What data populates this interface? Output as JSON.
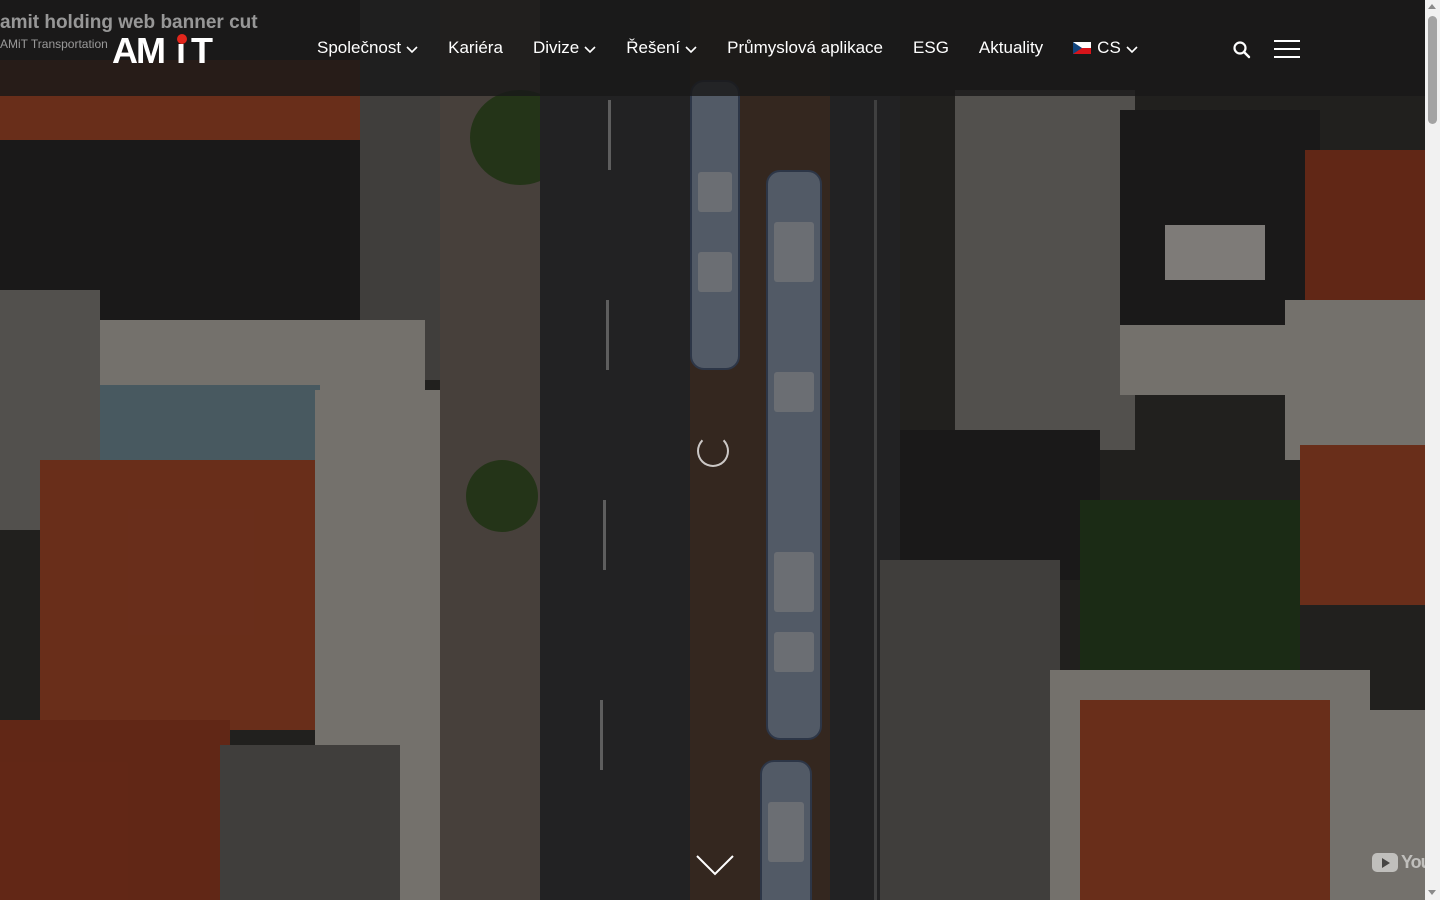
{
  "video": {
    "title": "amit holding web banner cut",
    "channel": "AMiT Transportation"
  },
  "header": {
    "logo_text": "AMiT",
    "nav": [
      {
        "label": "Společnost",
        "has_dropdown": true
      },
      {
        "label": "Kariéra",
        "has_dropdown": false
      },
      {
        "label": "Divize",
        "has_dropdown": true
      },
      {
        "label": "Řešení",
        "has_dropdown": true
      },
      {
        "label": "Průmyslová aplikace",
        "has_dropdown": false
      },
      {
        "label": "ESG",
        "has_dropdown": false
      },
      {
        "label": "Aktuality",
        "has_dropdown": false
      }
    ],
    "language": {
      "code": "CS",
      "flag": "czech-flag-icon"
    },
    "icons": {
      "search": "search-icon",
      "menu": "hamburger-menu-icon"
    }
  },
  "hero": {
    "state": "loading",
    "scroll_hint": "chevron-down-icon",
    "youtube_badge": "You"
  },
  "colors": {
    "header_bg": "#191919",
    "logo_red": "#e2261c",
    "text": "#ffffff"
  }
}
